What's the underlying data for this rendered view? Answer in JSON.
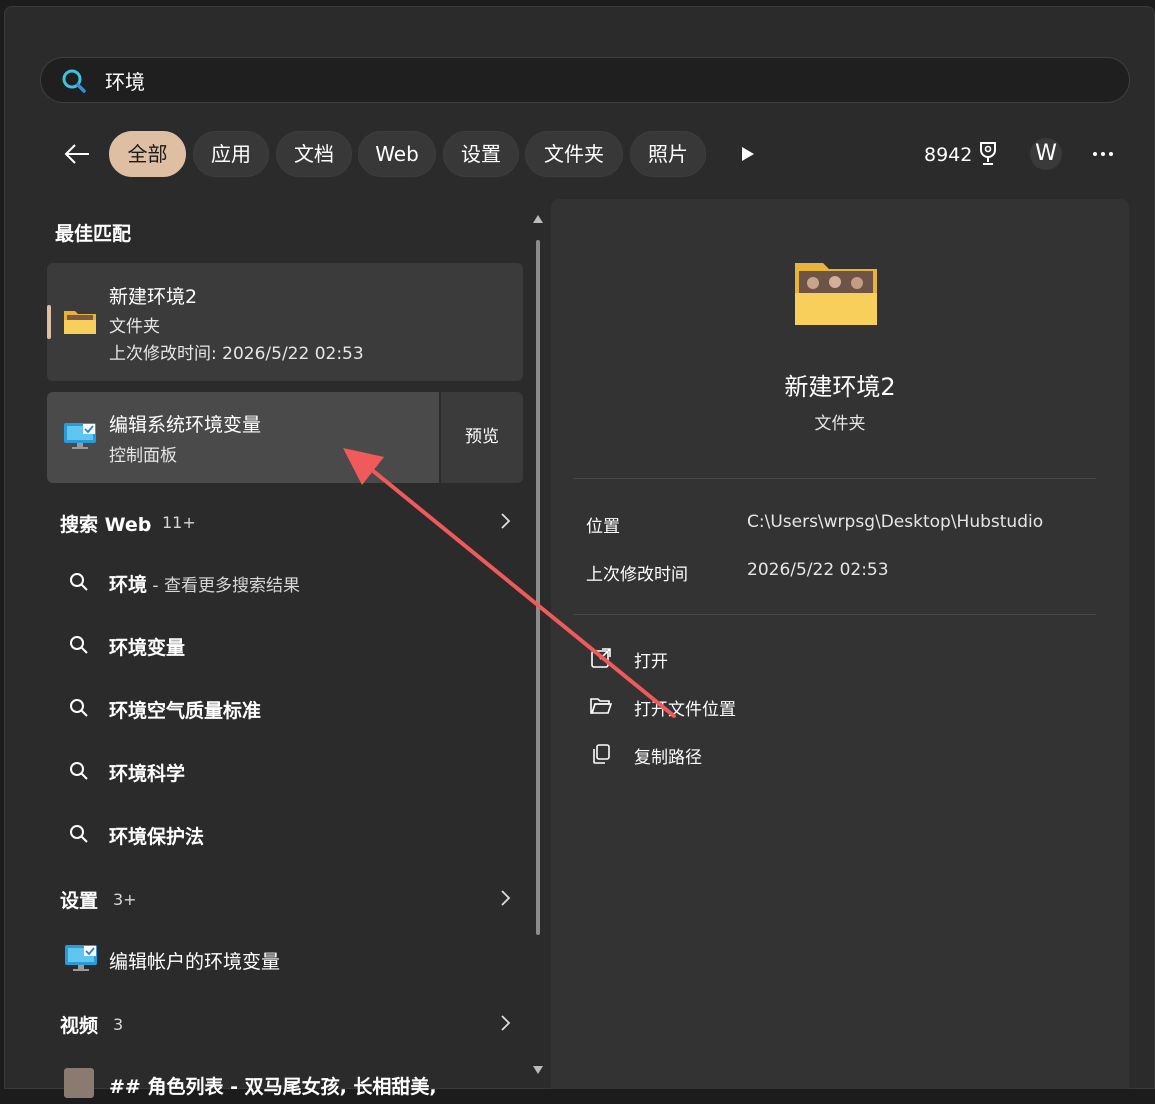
{
  "search": {
    "query": "环境"
  },
  "filters": [
    {
      "label": "全部",
      "active": true
    },
    {
      "label": "应用"
    },
    {
      "label": "文档"
    },
    {
      "label": "Web"
    },
    {
      "label": "设置"
    },
    {
      "label": "文件夹"
    },
    {
      "label": "照片"
    }
  ],
  "header": {
    "points": "8942",
    "avatar_letter": "W"
  },
  "best_match": {
    "section_title": "最佳匹配",
    "item": {
      "title": "新建环境2",
      "type": "文件夹",
      "modified": "上次修改时间: 2026/5/22 02:53"
    },
    "second": {
      "title": "编辑系统环境变量",
      "subtitle": "控制面板",
      "preview_label": "预览"
    }
  },
  "web_section": {
    "title": "搜索 Web",
    "count": "11+",
    "suggestions": [
      {
        "text": "环境",
        "hint": " - 查看更多搜索结果"
      },
      {
        "text": "环境变量"
      },
      {
        "text": "环境空气质量标准"
      },
      {
        "text": "环境科学"
      },
      {
        "text": "环境保护法"
      }
    ]
  },
  "settings_section": {
    "title": "设置",
    "count": "3+",
    "item": "编辑帐户的环境变量"
  },
  "video_section": {
    "title": "视频",
    "count": "3",
    "item": "## 角色列表 - 双马尾女孩, 长相甜美,"
  },
  "detail": {
    "title": "新建环境2",
    "type": "文件夹",
    "location_label": "位置",
    "location_value": "C:\\Users\\wrpsg\\Desktop\\Hubstudio",
    "modified_label": "上次修改时间",
    "modified_value": "2026/5/22 02:53",
    "actions": [
      "打开",
      "打开文件位置",
      "复制路径"
    ]
  },
  "colors": {
    "accent": "#dfbfa3",
    "annotation_arrow": "#f05a5a"
  }
}
